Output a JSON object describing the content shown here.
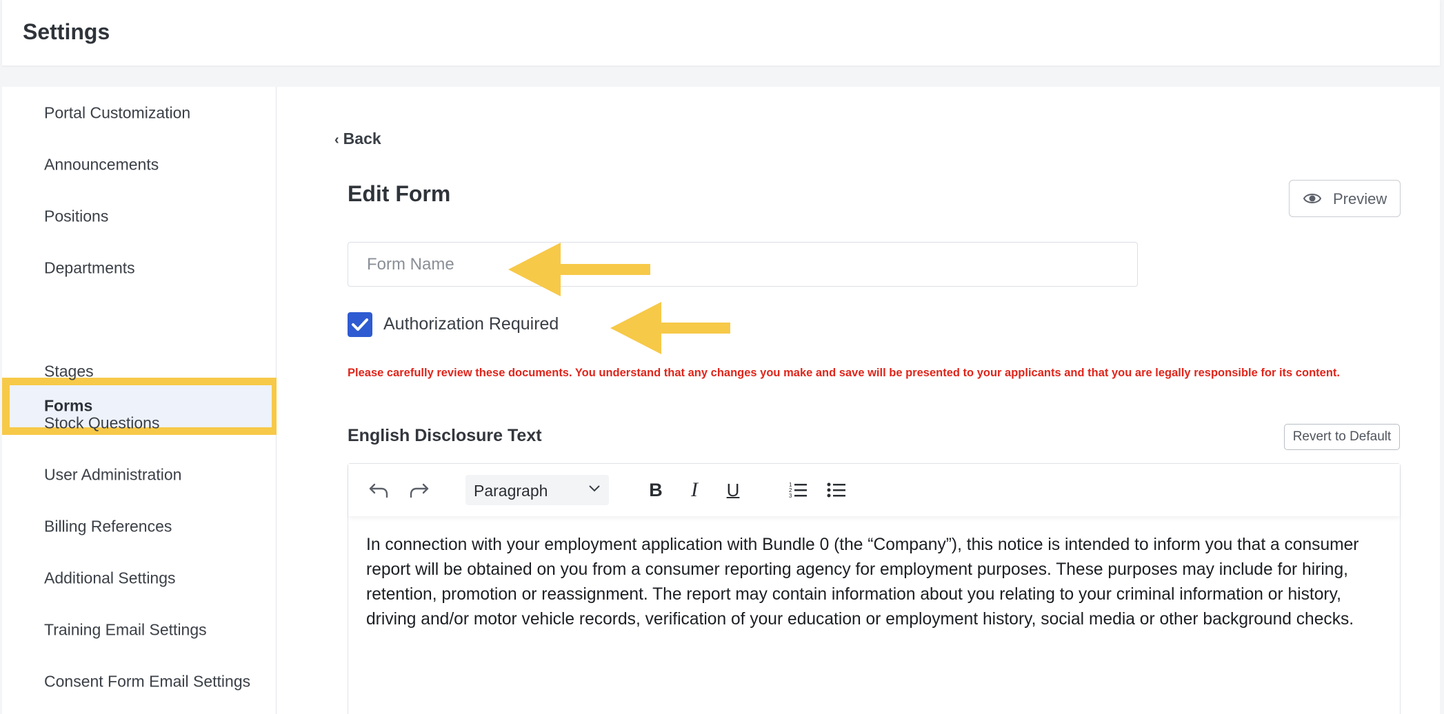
{
  "header": {
    "title": "Settings"
  },
  "sidebar": {
    "items": [
      {
        "label": "Portal Customization",
        "active": false
      },
      {
        "label": "Announcements",
        "active": false
      },
      {
        "label": "Positions",
        "active": false
      },
      {
        "label": "Departments",
        "active": false
      },
      {
        "label": "Forms",
        "active": true
      },
      {
        "label": "Stages",
        "active": false
      },
      {
        "label": "Stock Questions",
        "active": false
      },
      {
        "label": "User Administration",
        "active": false
      },
      {
        "label": "Billing References",
        "active": false
      },
      {
        "label": "Additional Settings",
        "active": false
      },
      {
        "label": "Training Email Settings",
        "active": false
      },
      {
        "label": "Consent Form Email Settings",
        "active": false
      }
    ]
  },
  "main": {
    "back_label": "Back",
    "title": "Edit Form",
    "preview_label": "Preview",
    "form_name": {
      "value": "",
      "placeholder": "Form Name"
    },
    "auth_checkbox": {
      "label": "Authorization Required",
      "checked": true
    },
    "warning": "Please carefully review these documents. You understand that any changes you make and save will be presented to your applicants and that you are legally responsible for its content.",
    "disclosure": {
      "title": "English Disclosure Text",
      "revert_label": "Revert to Default",
      "toolbar": {
        "icons": [
          "undo-icon",
          "redo-icon",
          "bold-icon",
          "italic-icon",
          "underline-icon",
          "numbered-list-icon",
          "bulleted-list-icon"
        ],
        "block_format": "Paragraph",
        "bold": "B",
        "italic": "I",
        "underline": "U"
      },
      "body": "In connection with your employment application with Bundle 0 (the “Company”), this notice is intended to inform you that a consumer report will be obtained on you from a consumer reporting agency for employment purposes. These purposes may include for hiring, retention, promotion or reassignment. The report may contain information about you relating to your criminal information or history, driving and/or motor vehicle records, verification of your education or employment history, social media or other background checks."
    }
  },
  "colors": {
    "accent": "#2e5bd1",
    "highlight": "#f7c948",
    "warning": "#e0251b",
    "active_bg": "#eef2fb"
  }
}
